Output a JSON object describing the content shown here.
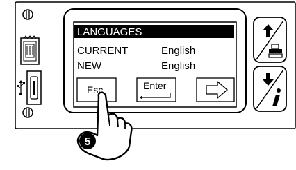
{
  "screen": {
    "title": "LANGUAGES",
    "current_label": "CURRENT",
    "current_value": "English",
    "new_label": "NEW",
    "new_value": "English"
  },
  "buttons": {
    "esc": "Esc",
    "enter": "Enter"
  },
  "step": {
    "number": "5"
  }
}
